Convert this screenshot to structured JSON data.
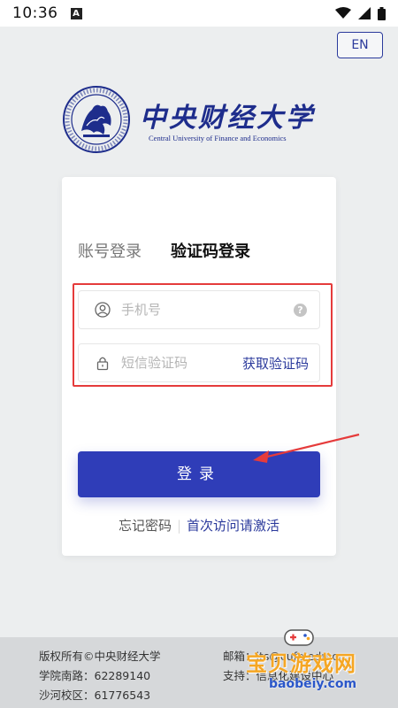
{
  "status_bar": {
    "time": "10:36",
    "notification_letter": "A"
  },
  "header": {
    "language_button": "EN"
  },
  "logo": {
    "name_cn": "中央财经大学",
    "name_en": "Central University of Finance and Economics",
    "brand_color": "#1e2d8c"
  },
  "login": {
    "tabs": [
      {
        "label": "账号登录",
        "active": false
      },
      {
        "label": "验证码登录",
        "active": true
      }
    ],
    "phone_placeholder": "手机号",
    "code_placeholder": "短信验证码",
    "help_symbol": "?",
    "get_code_label": "获取验证码",
    "submit_label": "登录",
    "forgot_password": "忘记密码",
    "separator": "|",
    "first_visit_activate": "首次访问请激活",
    "accent_color": "#2f3db8"
  },
  "footer": {
    "copyright": "版权所有©中央财经大学",
    "nanlu_campus": "学院南路：62289140",
    "shahe_campus": "沙河校区：61776543",
    "email": "邮箱：its@cufe.edu.cn",
    "support": "支持：信息化建设中心"
  },
  "watermark": {
    "text": "宝贝游戏网",
    "url": "baobeiy.com"
  }
}
